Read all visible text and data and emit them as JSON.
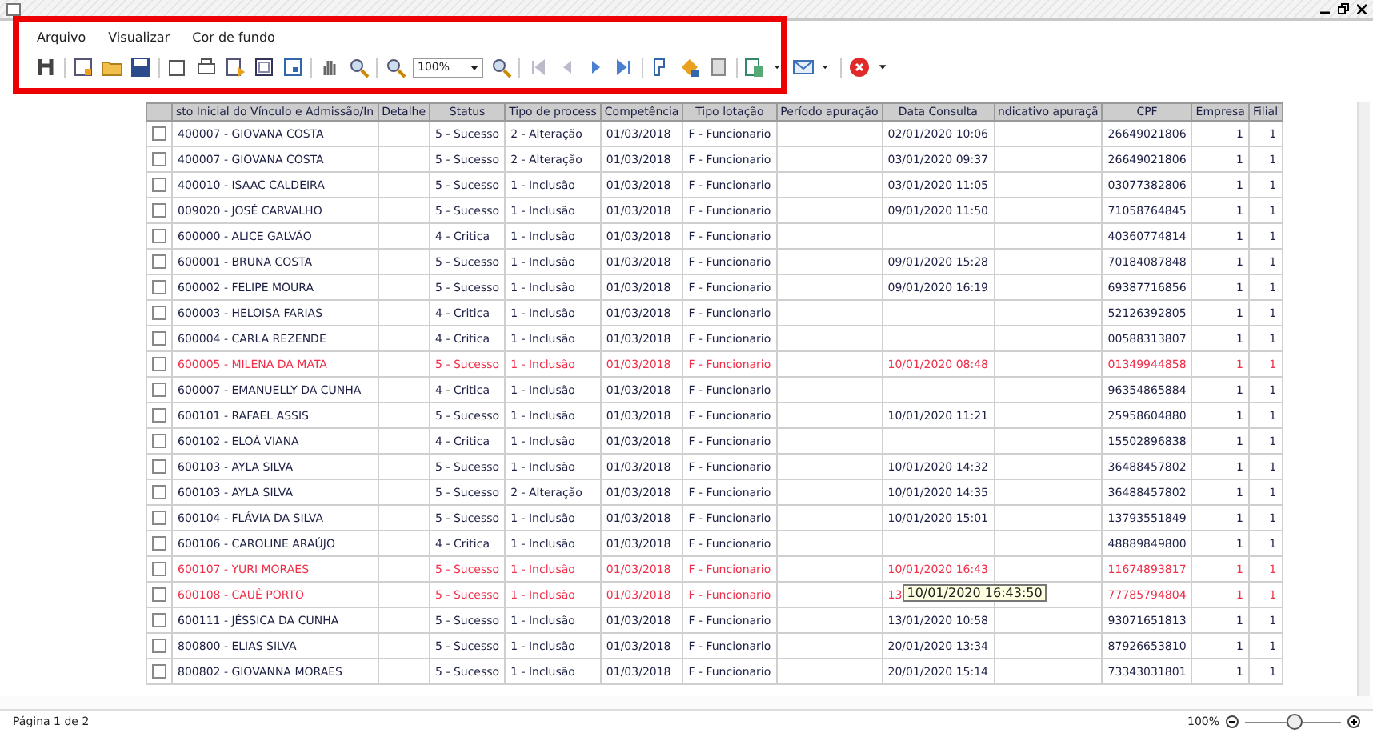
{
  "menu": [
    {
      "label": "Arquivo"
    },
    {
      "label": "Visualizar"
    },
    {
      "label": "Cor de fundo"
    }
  ],
  "toolbar": {
    "zoom": "100%"
  },
  "table": {
    "columns": [
      "sto Inicial do Vínculo e Admissão/In",
      "Detalhe",
      "Status",
      "Tipo de process",
      "Competência",
      "Tipo lotação",
      "Período apuração",
      "Data Consulta",
      "ndicativo apuraçã",
      "CPF",
      "Empresa",
      "Filial"
    ],
    "rows": [
      {
        "checked": false,
        "highlighted": false,
        "cells": [
          "400007 - GIOVANA COSTA",
          "",
          "5 - Sucesso",
          "2 - Alteração",
          "01/03/2018",
          "F - Funcionario",
          "",
          "02/01/2020 10:06",
          "",
          "26649021806",
          "1",
          "1"
        ]
      },
      {
        "checked": false,
        "highlighted": false,
        "cells": [
          "400007 - GIOVANA COSTA",
          "",
          "5 - Sucesso",
          "2 - Alteração",
          "01/03/2018",
          "F - Funcionario",
          "",
          "03/01/2020 09:37",
          "",
          "26649021806",
          "1",
          "1"
        ]
      },
      {
        "checked": false,
        "highlighted": false,
        "cells": [
          "400010 - ISAAC CALDEIRA",
          "",
          "5 - Sucesso",
          "1 - Inclusão",
          "01/03/2018",
          "F - Funcionario",
          "",
          "03/01/2020 11:05",
          "",
          "03077382806",
          "1",
          "1"
        ]
      },
      {
        "checked": false,
        "highlighted": false,
        "cells": [
          "009020 - JOSÉ CARVALHO",
          "",
          "5 - Sucesso",
          "1 - Inclusão",
          "01/03/2018",
          "F - Funcionario",
          "",
          "09/01/2020 11:50",
          "",
          "71058764845",
          "1",
          "1"
        ]
      },
      {
        "checked": false,
        "highlighted": false,
        "cells": [
          "600000 - ALICE GALVÃO",
          "",
          "4 - Critica",
          "1 - Inclusão",
          "01/03/2018",
          "F - Funcionario",
          "",
          "",
          "",
          "40360774814",
          "1",
          "1"
        ]
      },
      {
        "checked": false,
        "highlighted": false,
        "cells": [
          "600001 - BRUNA COSTA",
          "",
          "5 - Sucesso",
          "1 - Inclusão",
          "01/03/2018",
          "F - Funcionario",
          "",
          "09/01/2020 15:28",
          "",
          "70184087848",
          "1",
          "1"
        ]
      },
      {
        "checked": false,
        "highlighted": false,
        "cells": [
          "600002 - FELIPE MOURA",
          "",
          "5 - Sucesso",
          "1 - Inclusão",
          "01/03/2018",
          "F - Funcionario",
          "",
          "09/01/2020 16:19",
          "",
          "69387716856",
          "1",
          "1"
        ]
      },
      {
        "checked": false,
        "highlighted": false,
        "cells": [
          "600003 - HELOISA FARIAS",
          "",
          "4 - Critica",
          "1 - Inclusão",
          "01/03/2018",
          "F - Funcionario",
          "",
          "",
          "",
          "52126392805",
          "1",
          "1"
        ]
      },
      {
        "checked": false,
        "highlighted": false,
        "cells": [
          "600004 - CARLA REZENDE",
          "",
          "4 - Critica",
          "1 - Inclusão",
          "01/03/2018",
          "F - Funcionario",
          "",
          "",
          "",
          "00588313807",
          "1",
          "1"
        ]
      },
      {
        "checked": false,
        "highlighted": true,
        "cells": [
          "600005 - MILENA DA MATA",
          "",
          "5 - Sucesso",
          "1 - Inclusão",
          "01/03/2018",
          "F - Funcionario",
          "",
          "10/01/2020 08:48",
          "",
          "01349944858",
          "1",
          "1"
        ]
      },
      {
        "checked": false,
        "highlighted": false,
        "cells": [
          "600007 - EMANUELLY DA CUNHA",
          "",
          "4 - Critica",
          "1 - Inclusão",
          "01/03/2018",
          "F - Funcionario",
          "",
          "",
          "",
          "96354865884",
          "1",
          "1"
        ]
      },
      {
        "checked": false,
        "highlighted": false,
        "cells": [
          "600101 - RAFAEL ASSIS",
          "",
          "5 - Sucesso",
          "1 - Inclusão",
          "01/03/2018",
          "F - Funcionario",
          "",
          "10/01/2020 11:21",
          "",
          "25958604880",
          "1",
          "1"
        ]
      },
      {
        "checked": false,
        "highlighted": false,
        "cells": [
          "600102 - ELOÁ VIANA",
          "",
          "4 - Critica",
          "1 - Inclusão",
          "01/03/2018",
          "F - Funcionario",
          "",
          "",
          "",
          "15502896838",
          "1",
          "1"
        ]
      },
      {
        "checked": false,
        "highlighted": false,
        "cells": [
          "600103 - AYLA SILVA",
          "",
          "5 - Sucesso",
          "1 - Inclusão",
          "01/03/2018",
          "F - Funcionario",
          "",
          "10/01/2020 14:32",
          "",
          "36488457802",
          "1",
          "1"
        ]
      },
      {
        "checked": false,
        "highlighted": false,
        "cells": [
          "600103 - AYLA SILVA",
          "",
          "5 - Sucesso",
          "2 - Alteração",
          "01/03/2018",
          "F - Funcionario",
          "",
          "10/01/2020 14:35",
          "",
          "36488457802",
          "1",
          "1"
        ]
      },
      {
        "checked": false,
        "highlighted": false,
        "cells": [
          "600104 - FLÁVIA DA SILVA",
          "",
          "5 - Sucesso",
          "1 - Inclusão",
          "01/03/2018",
          "F - Funcionario",
          "",
          "10/01/2020 15:01",
          "",
          "13793551849",
          "1",
          "1"
        ]
      },
      {
        "checked": false,
        "highlighted": false,
        "cells": [
          "600106 - CAROLINE ARAÚJO",
          "",
          "4 - Critica",
          "1 - Inclusão",
          "01/03/2018",
          "F - Funcionario",
          "",
          "",
          "",
          "48889849800",
          "1",
          "1"
        ]
      },
      {
        "checked": false,
        "highlighted": true,
        "cells": [
          "600107 - YURI MORAES",
          "",
          "5 - Sucesso",
          "1 - Inclusão",
          "01/03/2018",
          "F - Funcionario",
          "",
          "10/01/2020 16:43",
          "",
          "11674893817",
          "1",
          "1"
        ]
      },
      {
        "checked": false,
        "highlighted": true,
        "cells": [
          "600108 - CAUÊ PORTO",
          "",
          "5 - Sucesso",
          "1 - Inclusão",
          "01/03/2018",
          "F - Funcionario",
          "",
          "13",
          "",
          "77785794804",
          "1",
          "1"
        ],
        "tooltip": "10/01/2020 16:43:50"
      },
      {
        "checked": false,
        "highlighted": false,
        "cells": [
          "600111 - JÉSSICA DA CUNHA",
          "",
          "5 - Sucesso",
          "1 - Inclusão",
          "01/03/2018",
          "F - Funcionario",
          "",
          "13/01/2020 10:58",
          "",
          "93071651813",
          "1",
          "1"
        ]
      },
      {
        "checked": false,
        "highlighted": false,
        "cells": [
          "800800 - ELIAS SILVA",
          "",
          "5 - Sucesso",
          "1 - Inclusão",
          "01/03/2018",
          "F - Funcionario",
          "",
          "20/01/2020 13:34",
          "",
          "87926653810",
          "1",
          "1"
        ]
      },
      {
        "checked": false,
        "highlighted": false,
        "cells": [
          "800802 - GIOVANNA MORAES",
          "",
          "5 - Sucesso",
          "1 - Inclusão",
          "01/03/2018",
          "F - Funcionario",
          "",
          "20/01/2020 15:14",
          "",
          "73343031801",
          "1",
          "1"
        ]
      }
    ]
  },
  "status_bar": {
    "page": "Página 1 de 2",
    "zoom": "100%",
    "level": 0.5
  }
}
